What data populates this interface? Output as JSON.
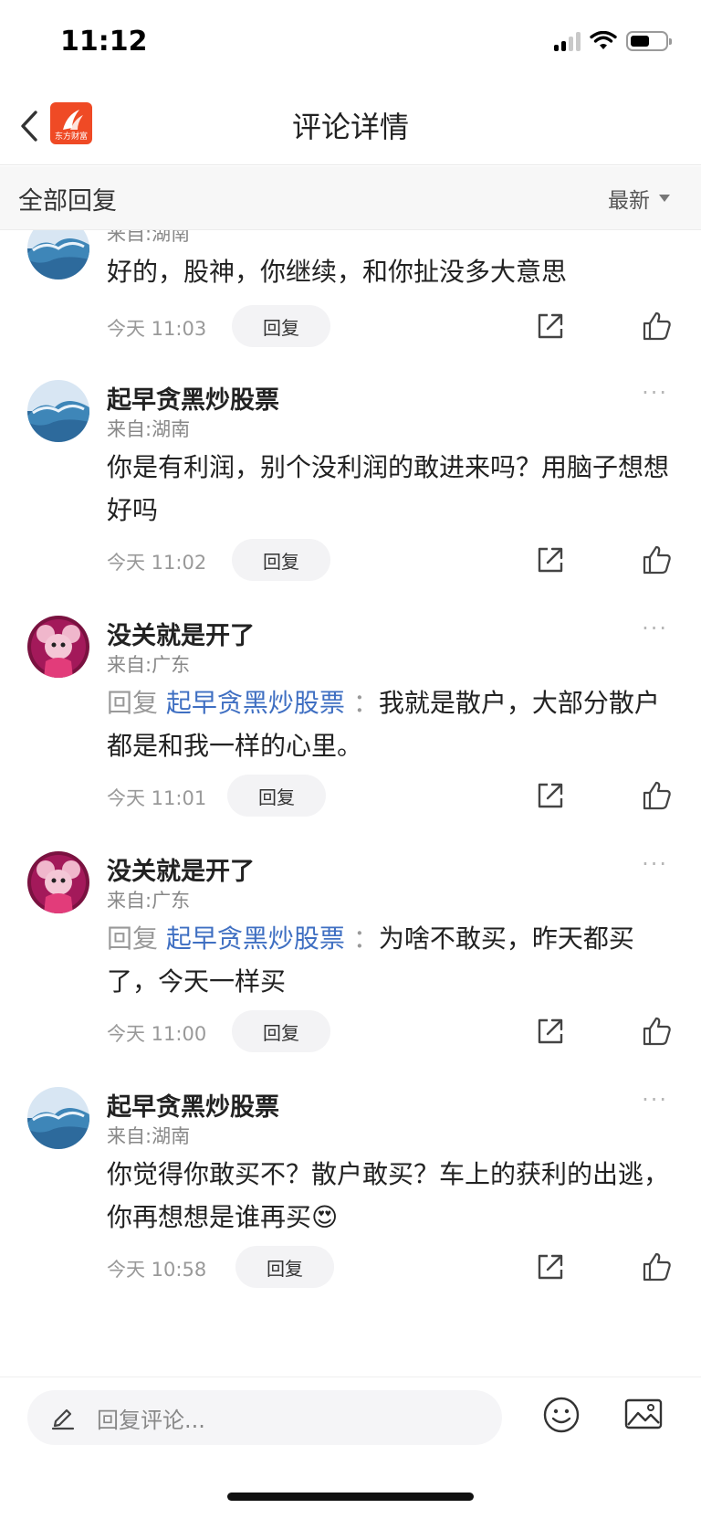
{
  "status_bar": {
    "time": "11:12"
  },
  "nav": {
    "title": "评论详情",
    "logo_text": "东方财富"
  },
  "filter": {
    "title": "全部回复",
    "sort_label": "最新"
  },
  "comments": [
    {
      "user": "",
      "location": "来自:湖南",
      "text": "好的，股神，你继续，和你扯没多大意思",
      "time": "今天 11:03",
      "reply_label": "回复"
    },
    {
      "user": "起早贪黑炒股票",
      "location": "来自:湖南",
      "text": "你是有利润，别个没利润的敢进来吗？用脑子想想好吗",
      "time": "今天 11:02",
      "reply_label": "回复",
      "more": "···"
    },
    {
      "user": "没关就是开了",
      "location": "来自:广东",
      "reply_prefix": "回复",
      "reply_to": "起早贪黑炒股票",
      "colon": "：",
      "text": "我就是散户，大部分散户都是和我一样的心里。",
      "time": "今天 11:01",
      "reply_label": "回复",
      "more": "···"
    },
    {
      "user": "没关就是开了",
      "location": "来自:广东",
      "reply_prefix": "回复",
      "reply_to": "起早贪黑炒股票",
      "colon": "：",
      "text": "为啥不敢买，昨天都买了，今天一样买",
      "time": "今天 11:00",
      "reply_label": "回复",
      "more": "···"
    },
    {
      "user": "起早贪黑炒股票",
      "location": "来自:湖南",
      "text": "你觉得你敢买不？散户敢买？车上的获利的出逃，你再想想是谁再买",
      "emoji": "😍",
      "time": "今天 10:58",
      "reply_label": "回复",
      "more": "···"
    }
  ],
  "input_bar": {
    "placeholder": "回复评论..."
  },
  "icons": {
    "back": "back-arrow-icon",
    "share": "share-icon",
    "like": "thumbs-up-icon",
    "pencil": "pencil-icon",
    "emoji": "smiley-icon",
    "image": "image-icon"
  },
  "colors": {
    "brand": "#ef4a25",
    "link": "#3f6fc2",
    "muted": "#999999"
  }
}
